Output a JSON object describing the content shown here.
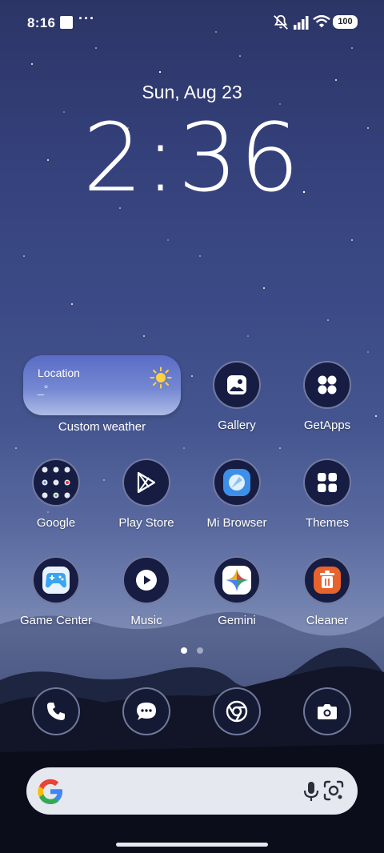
{
  "status_bar": {
    "time": "8:16",
    "overflow": "···",
    "battery": "100",
    "icons": [
      "stop-icon",
      "mute-icon",
      "signal-icon",
      "wifi-icon",
      "battery-icon"
    ]
  },
  "clock": {
    "date": "Sun, Aug 23",
    "time": "2:36"
  },
  "weather": {
    "location": "Location",
    "temp": "_°",
    "caption": "Custom weather",
    "icon": "sun-icon"
  },
  "apps": [
    {
      "label": "Gallery",
      "icon": "gallery-icon"
    },
    {
      "label": "GetApps",
      "icon": "getapps-icon"
    },
    {
      "label": "Google",
      "icon": "google-folder-icon"
    },
    {
      "label": "Play Store",
      "icon": "play-store-icon"
    },
    {
      "label": "Mi Browser",
      "icon": "mi-browser-icon"
    },
    {
      "label": "Themes",
      "icon": "themes-icon"
    },
    {
      "label": "Game Center",
      "icon": "game-center-icon"
    },
    {
      "label": "Music",
      "icon": "music-icon"
    },
    {
      "label": "Gemini",
      "icon": "gemini-icon"
    },
    {
      "label": "Cleaner",
      "icon": "cleaner-icon"
    }
  ],
  "dock": [
    "phone-icon",
    "messages-icon",
    "chrome-icon",
    "camera-icon"
  ],
  "pagination": {
    "pages": 2,
    "current": 1
  },
  "search": {
    "icons": [
      "google-g-icon",
      "mic-icon",
      "lens-icon"
    ]
  },
  "colors": {
    "accent_orange": "#e8622c",
    "gemini_blue": "#4a7ef7",
    "browser_blue": "#3d8fe8"
  }
}
